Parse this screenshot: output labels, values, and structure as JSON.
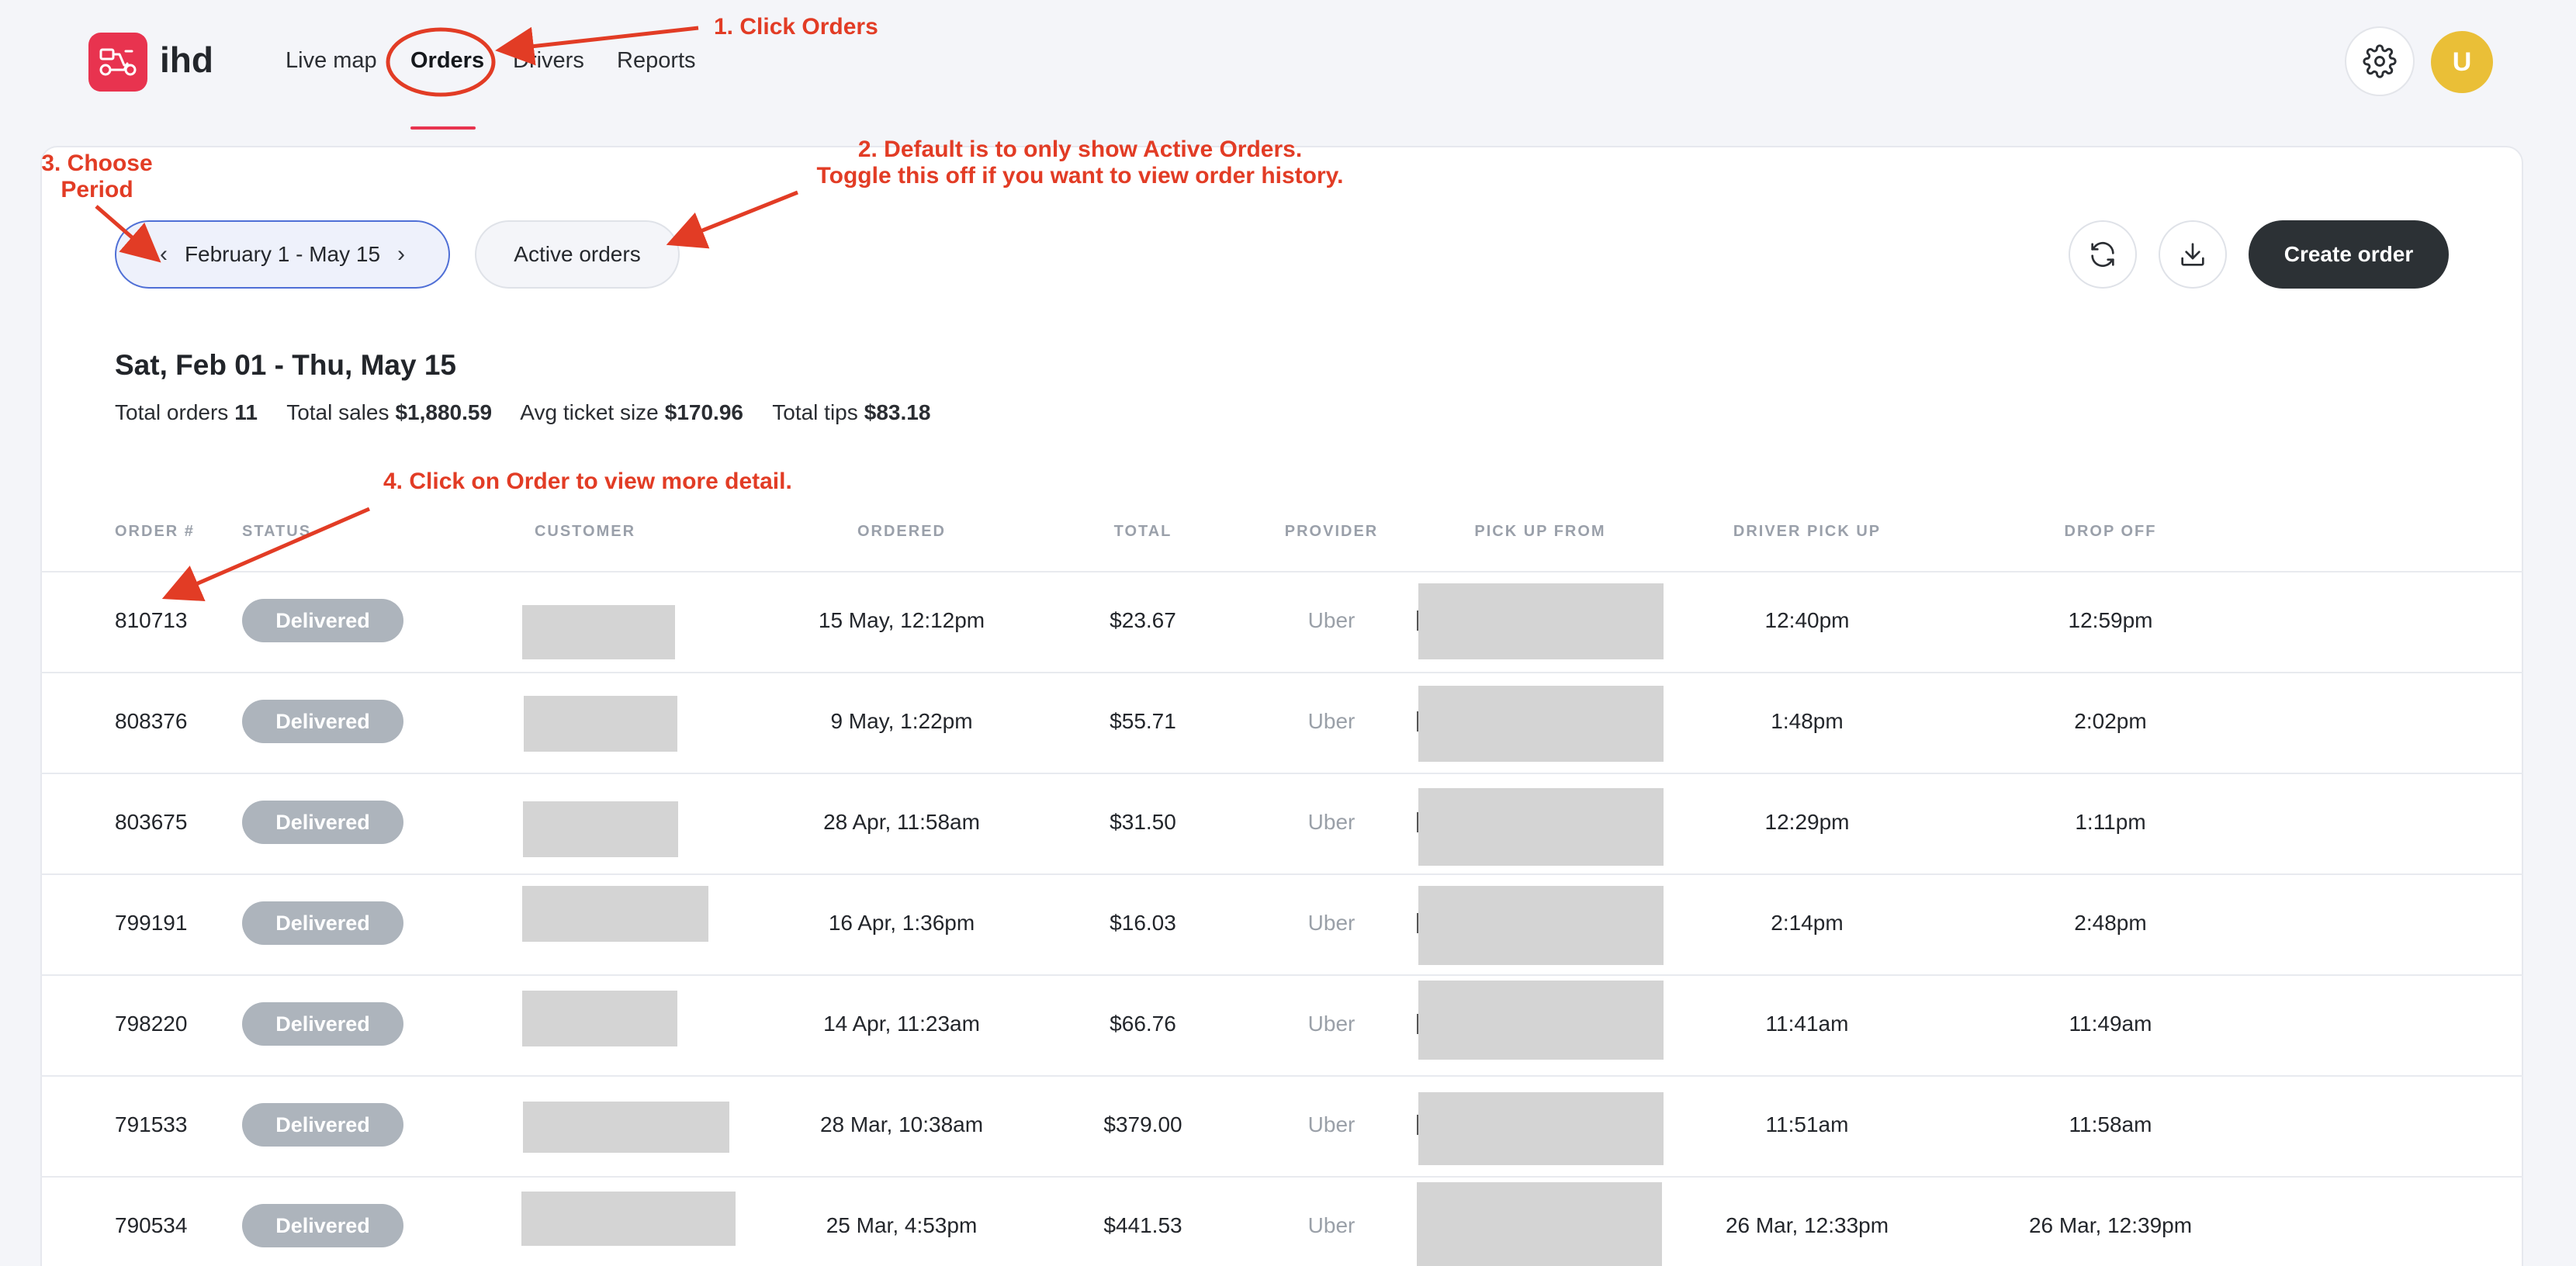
{
  "app": {
    "logo_text": "ihd",
    "brand_color": "#e8334f"
  },
  "nav": {
    "items": [
      "Live map",
      "Orders",
      "Drivers",
      "Reports"
    ],
    "active": "Orders"
  },
  "header": {
    "avatar_initial": "U",
    "avatar_color": "#eabf37"
  },
  "toolbar": {
    "period_label": "February 1 - May 15",
    "active_orders_label": "Active orders",
    "create_order_label": "Create order"
  },
  "summary": {
    "range_title": "Sat, Feb 01 - Thu, May 15",
    "total_orders_label": "Total orders",
    "total_orders": "11",
    "total_sales_label": "Total sales",
    "total_sales": "$1,880.59",
    "avg_ticket_label": "Avg ticket size",
    "avg_ticket": "$170.96",
    "total_tips_label": "Total tips",
    "total_tips": "$83.18"
  },
  "table": {
    "columns": [
      "ORDER #",
      "STATUS",
      "CUSTOMER",
      "ORDERED",
      "TOTAL",
      "PROVIDER",
      "PICK UP FROM",
      "DRIVER PICK UP",
      "DROP OFF"
    ],
    "rows": [
      {
        "order": "810713",
        "status": "Delivered",
        "ordered": "15 May, 12:12pm",
        "total": "$23.67",
        "provider": "Uber",
        "driver_pickup": "12:40pm",
        "drop_off": "12:59pm"
      },
      {
        "order": "808376",
        "status": "Delivered",
        "ordered": "9 May, 1:22pm",
        "total": "$55.71",
        "provider": "Uber",
        "driver_pickup": "1:48pm",
        "drop_off": "2:02pm"
      },
      {
        "order": "803675",
        "status": "Delivered",
        "ordered": "28 Apr, 11:58am",
        "total": "$31.50",
        "provider": "Uber",
        "driver_pickup": "12:29pm",
        "drop_off": "1:11pm"
      },
      {
        "order": "799191",
        "status": "Delivered",
        "ordered": "16 Apr, 1:36pm",
        "total": "$16.03",
        "provider": "Uber",
        "driver_pickup": "2:14pm",
        "drop_off": "2:48pm"
      },
      {
        "order": "798220",
        "status": "Delivered",
        "ordered": "14 Apr, 11:23am",
        "total": "$66.76",
        "provider": "Uber",
        "driver_pickup": "11:41am",
        "drop_off": "11:49am"
      },
      {
        "order": "791533",
        "status": "Delivered",
        "ordered": "28 Mar, 10:38am",
        "total": "$379.00",
        "provider": "Uber",
        "driver_pickup": "11:51am",
        "drop_off": "11:58am"
      },
      {
        "order": "790534",
        "status": "Delivered",
        "ordered": "25 Mar, 4:53pm",
        "total": "$441.53",
        "provider": "Uber",
        "driver_pickup": "26 Mar, 12:33pm",
        "drop_off": "26 Mar, 12:39pm"
      }
    ]
  },
  "annotations": {
    "a1": "1. Click Orders",
    "a2_line1": "2. Default is to only show Active Orders.",
    "a2_line2": "Toggle this off if you want to view order history.",
    "a3_line1": "3. Choose",
    "a3_line2": "Period",
    "a4": "4. Click on Order to view more detail.",
    "color": "#e23c25"
  }
}
